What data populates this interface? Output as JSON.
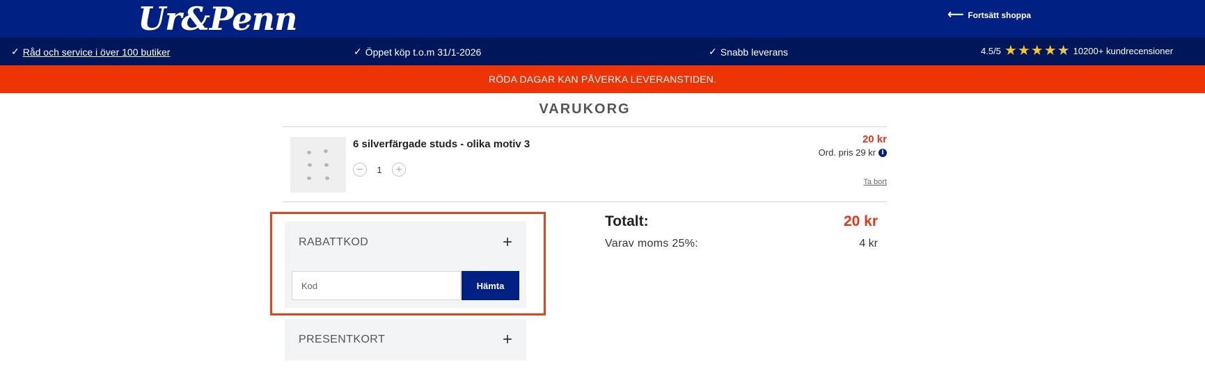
{
  "header": {
    "logo_text": "Ur&Penn",
    "continue_label": "Fortsätt shoppa"
  },
  "usp": {
    "item1": "Råd och service i över 100 butiker",
    "item2": "Öppet köp t.o.m 31/1-2026",
    "item3": "Snabb leverans",
    "rating": "4.5/5",
    "rating_value": 4.5,
    "rating_max": 5,
    "reviews": "10200+ kundrecensioner"
  },
  "alert": {
    "text": "RÖDA DAGAR KAN PÅVERKA LEVERANSTIDEN."
  },
  "cart": {
    "title": "VARUKORG",
    "item": {
      "name": "6 silverfärgade studs - olika motiv 3",
      "quantity": "1",
      "price": "20 kr",
      "ord_price": "Ord. pris 29 kr",
      "remove_label": "Ta bort"
    }
  },
  "discount": {
    "label": "RABATTKOD",
    "input_placeholder": "Kod",
    "button_label": "Hämta"
  },
  "giftcard": {
    "label": "PRESENTKORT"
  },
  "totals": {
    "total_label": "Totalt:",
    "total_value": "20 kr",
    "vat_label": "Varav moms 25%:",
    "vat_value": "4 kr"
  },
  "colors": {
    "header_bg": "#002083",
    "usp_bg": "#00165b",
    "alert_bg": "#ee3305",
    "price_red": "#e0371b",
    "highlight": "#e0461c"
  }
}
